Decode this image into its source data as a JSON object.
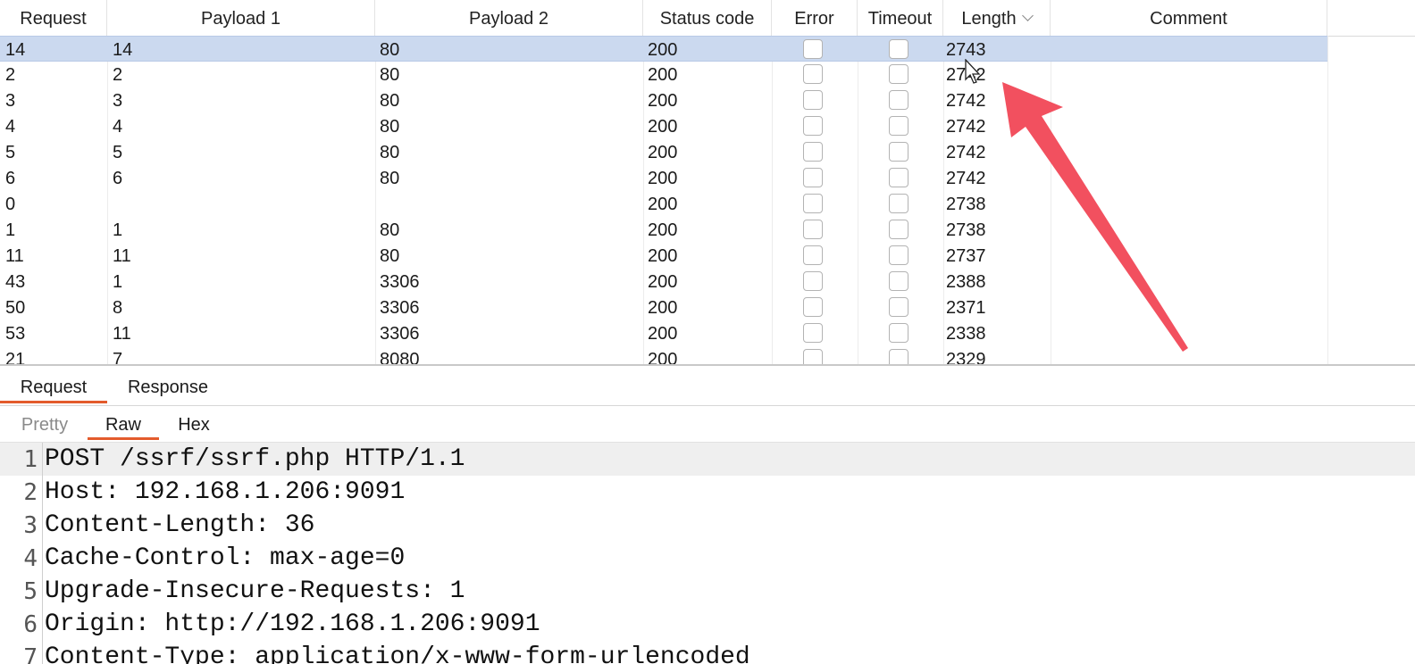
{
  "results_table": {
    "columns": [
      "Request",
      "Payload 1",
      "Payload 2",
      "Status code",
      "Error",
      "Timeout",
      "Length",
      "Comment"
    ],
    "sorted_column": "Length",
    "rows": [
      {
        "request": "14",
        "payload1": "14",
        "payload2": "80",
        "status": "200",
        "error": false,
        "timeout": false,
        "length": "2743",
        "comment": "",
        "selected": true
      },
      {
        "request": "2",
        "payload1": "2",
        "payload2": "80",
        "status": "200",
        "error": false,
        "timeout": false,
        "length": "2742",
        "comment": ""
      },
      {
        "request": "3",
        "payload1": "3",
        "payload2": "80",
        "status": "200",
        "error": false,
        "timeout": false,
        "length": "2742",
        "comment": ""
      },
      {
        "request": "4",
        "payload1": "4",
        "payload2": "80",
        "status": "200",
        "error": false,
        "timeout": false,
        "length": "2742",
        "comment": ""
      },
      {
        "request": "5",
        "payload1": "5",
        "payload2": "80",
        "status": "200",
        "error": false,
        "timeout": false,
        "length": "2742",
        "comment": ""
      },
      {
        "request": "6",
        "payload1": "6",
        "payload2": "80",
        "status": "200",
        "error": false,
        "timeout": false,
        "length": "2742",
        "comment": ""
      },
      {
        "request": "0",
        "payload1": "",
        "payload2": "",
        "status": "200",
        "error": false,
        "timeout": false,
        "length": "2738",
        "comment": ""
      },
      {
        "request": "1",
        "payload1": "1",
        "payload2": "80",
        "status": "200",
        "error": false,
        "timeout": false,
        "length": "2738",
        "comment": ""
      },
      {
        "request": "11",
        "payload1": "11",
        "payload2": "80",
        "status": "200",
        "error": false,
        "timeout": false,
        "length": "2737",
        "comment": ""
      },
      {
        "request": "43",
        "payload1": "1",
        "payload2": "3306",
        "status": "200",
        "error": false,
        "timeout": false,
        "length": "2388",
        "comment": ""
      },
      {
        "request": "50",
        "payload1": "8",
        "payload2": "3306",
        "status": "200",
        "error": false,
        "timeout": false,
        "length": "2371",
        "comment": ""
      },
      {
        "request": "53",
        "payload1": "11",
        "payload2": "3306",
        "status": "200",
        "error": false,
        "timeout": false,
        "length": "2338",
        "comment": ""
      },
      {
        "request": "21",
        "payload1": "7",
        "payload2": "8080",
        "status": "200",
        "error": false,
        "timeout": false,
        "length": "2329",
        "comment": ""
      }
    ]
  },
  "message_tabs": [
    {
      "label": "Request",
      "active": true
    },
    {
      "label": "Response",
      "active": false
    }
  ],
  "view_tabs": [
    {
      "label": "Pretty",
      "active": false
    },
    {
      "label": "Raw",
      "active": true
    },
    {
      "label": "Hex",
      "active": false
    }
  ],
  "editor_lines": [
    "POST /ssrf/ssrf.php HTTP/1.1",
    "Host: 192.168.1.206:9091",
    "Content-Length: 36",
    "Cache-Control: max-age=0",
    "Upgrade-Insecure-Requests: 1",
    "Origin: http://192.168.1.206:9091",
    "Content-Type: application/x-www-form-urlencoded"
  ],
  "editor_line_numbers": [
    "1",
    "2",
    "3",
    "4",
    "5",
    "6",
    "7"
  ],
  "colors": {
    "selected_row": "#cbd9ef",
    "active_tab_underline": "#e35b2c",
    "annotation_arrow": "#f2505f"
  },
  "icons": {
    "sort": "chevron-down-icon",
    "annotation": "arrow-annotation-icon",
    "pointer": "mouse-cursor-icon"
  }
}
